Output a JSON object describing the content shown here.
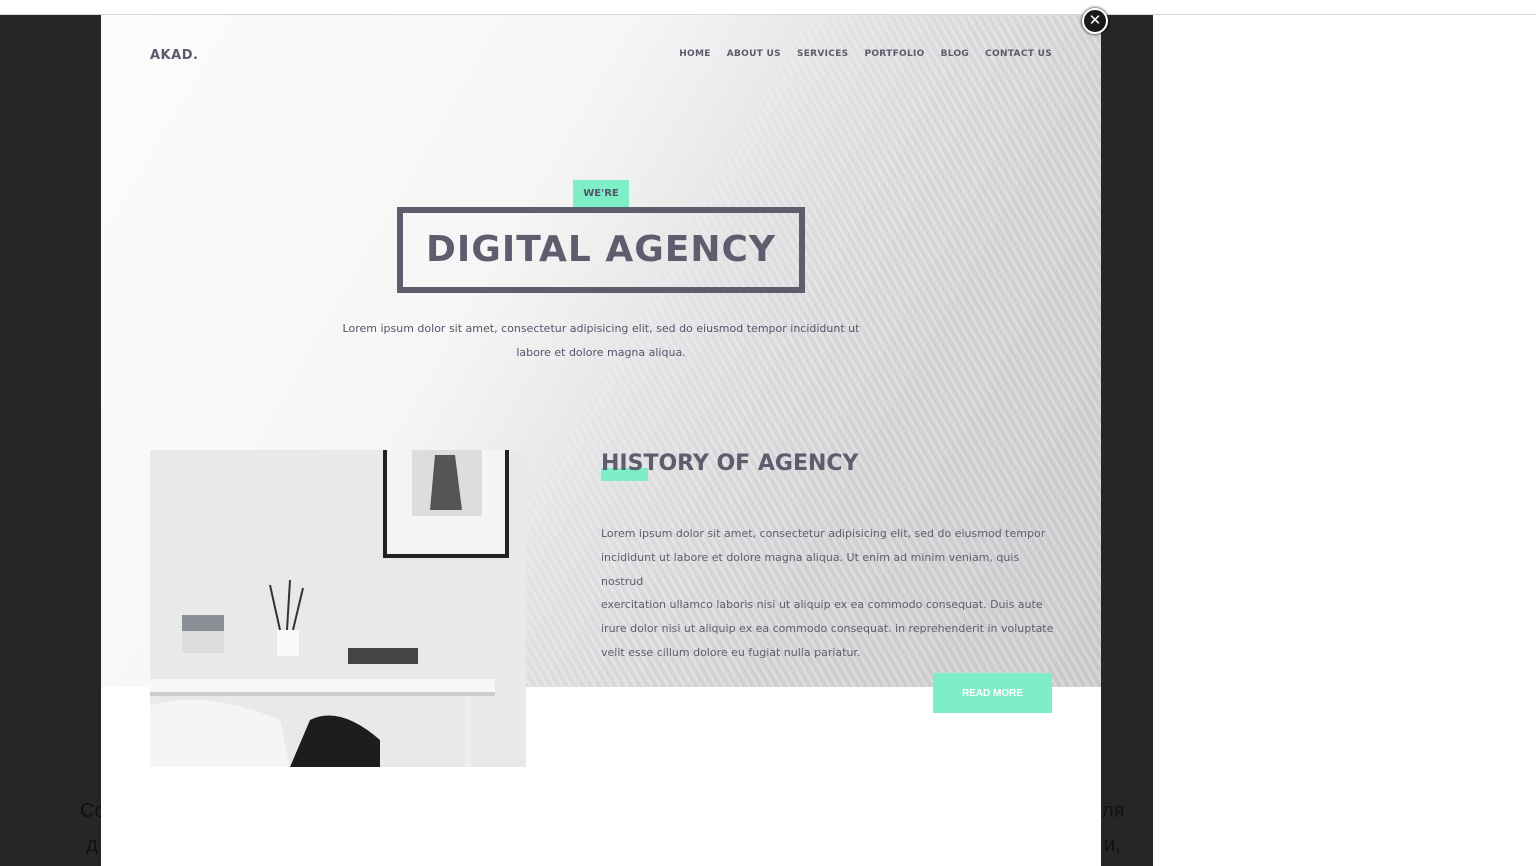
{
  "background_text": [
    "Co",
    "ля",
    "д",
    "и,"
  ],
  "site": {
    "logo": "AKAD.",
    "nav": [
      "HOME",
      "ABOUT US",
      "SERVICES",
      "PORTFOLIO",
      "BLOG",
      "CONTACT US"
    ],
    "hero": {
      "badge": "WE'RE",
      "title": "DIGITAL AGENCY",
      "text_lines": [
        "Lorem ipsum dolor sit amet, consectetur adipisicing elit, sed do eiusmod tempor incididunt ut",
        "labore et dolore magna aliqua."
      ]
    },
    "history": {
      "title": "HISTORY OF AGENCY",
      "text_lines": [
        "Lorem ipsum dolor sit amet, consectetur adipisicing elit, sed do eiusmod tempor",
        "incididunt ut labore et dolore magna aliqua. Ut enim ad minim veniam, quis nostrud",
        "exercitation ullamco laboris nisi ut aliquip ex ea commodo consequat. Duis aute",
        "irure dolor nisi ut aliquip ex ea commodo consequat. in reprehenderit in voluptate",
        "velit esse cillum dolore eu fugiat nulla pariatur."
      ],
      "button": "READ MORE"
    }
  },
  "close_label": "✕",
  "colors": {
    "accent": "#7deec6",
    "text": "#5e5d6e",
    "overlay": "#262626"
  }
}
